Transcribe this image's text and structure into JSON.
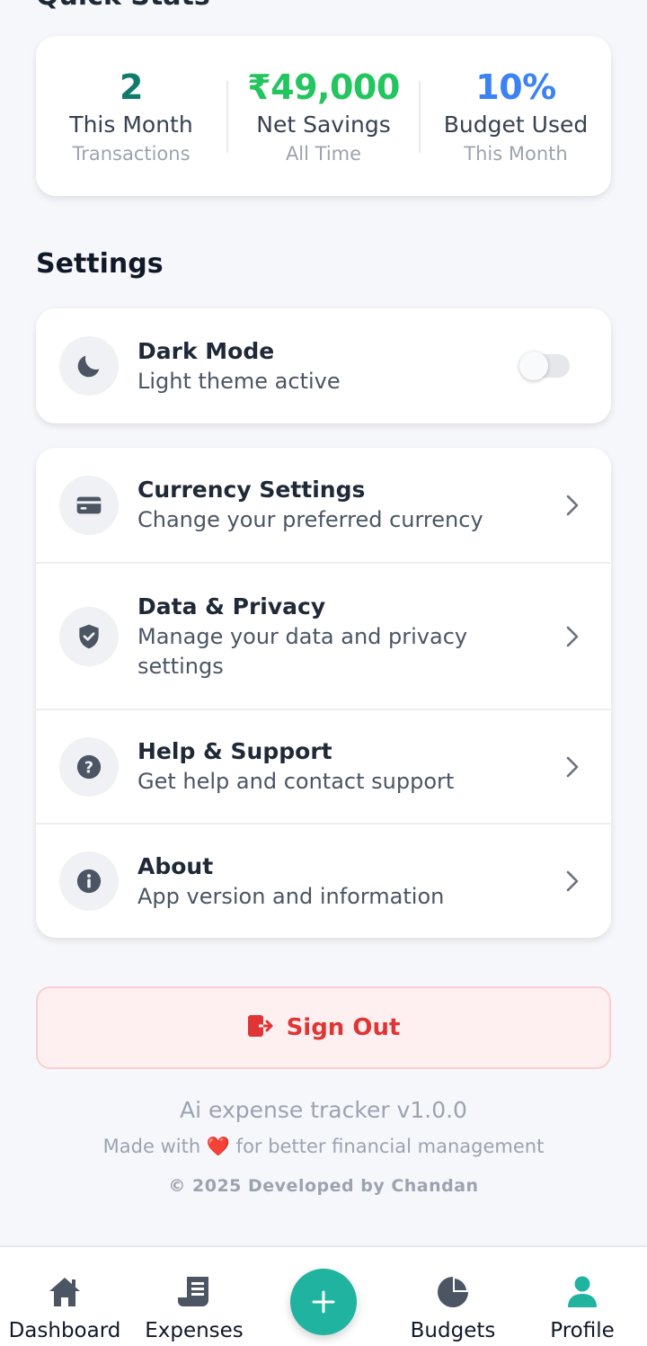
{
  "section_cut_title": "Quick Stats",
  "stats": [
    {
      "value": "2",
      "title": "This Month",
      "sub": "Transactions",
      "color": "#0f7a6e"
    },
    {
      "value": "₹49,000",
      "title": "Net Savings",
      "sub": "All Time",
      "color": "#22c55e"
    },
    {
      "value": "10%",
      "title": "Budget Used",
      "sub": "This Month",
      "color": "#3b82f6"
    }
  ],
  "settings": {
    "title": "Settings",
    "dark_mode": {
      "title": "Dark Mode",
      "subtitle": "Light theme active",
      "icon": "moon-icon",
      "enabled": false
    },
    "items": [
      {
        "title": "Currency Settings",
        "subtitle": "Change your preferred currency",
        "icon": "credit-card-icon"
      },
      {
        "title": "Data & Privacy",
        "subtitle": "Manage your data and privacy settings",
        "icon": "shield-check-icon"
      },
      {
        "title": "Help & Support",
        "subtitle": "Get help and contact support",
        "icon": "question-circle-icon"
      },
      {
        "title": "About",
        "subtitle": "App version and information",
        "icon": "info-circle-icon"
      }
    ]
  },
  "sign_out": {
    "label": "Sign Out",
    "icon": "sign-out-icon",
    "color": "#e03535"
  },
  "footer": {
    "version": "Ai expense tracker v1.0.0",
    "made_with_prefix": "Made with",
    "heart": "❤️",
    "made_with_suffix": "for better financial management",
    "copyright": "© 2025 Developed by Chandan"
  },
  "nav": {
    "items": [
      {
        "label": "Dashboard",
        "icon": "home-icon"
      },
      {
        "label": "Expenses",
        "icon": "receipt-icon"
      },
      {
        "label": "Budgets",
        "icon": "pie-chart-icon"
      },
      {
        "label": "Profile",
        "icon": "user-icon",
        "active": true
      }
    ],
    "fab_icon": "plus-icon",
    "accent": "#20b3a0"
  }
}
